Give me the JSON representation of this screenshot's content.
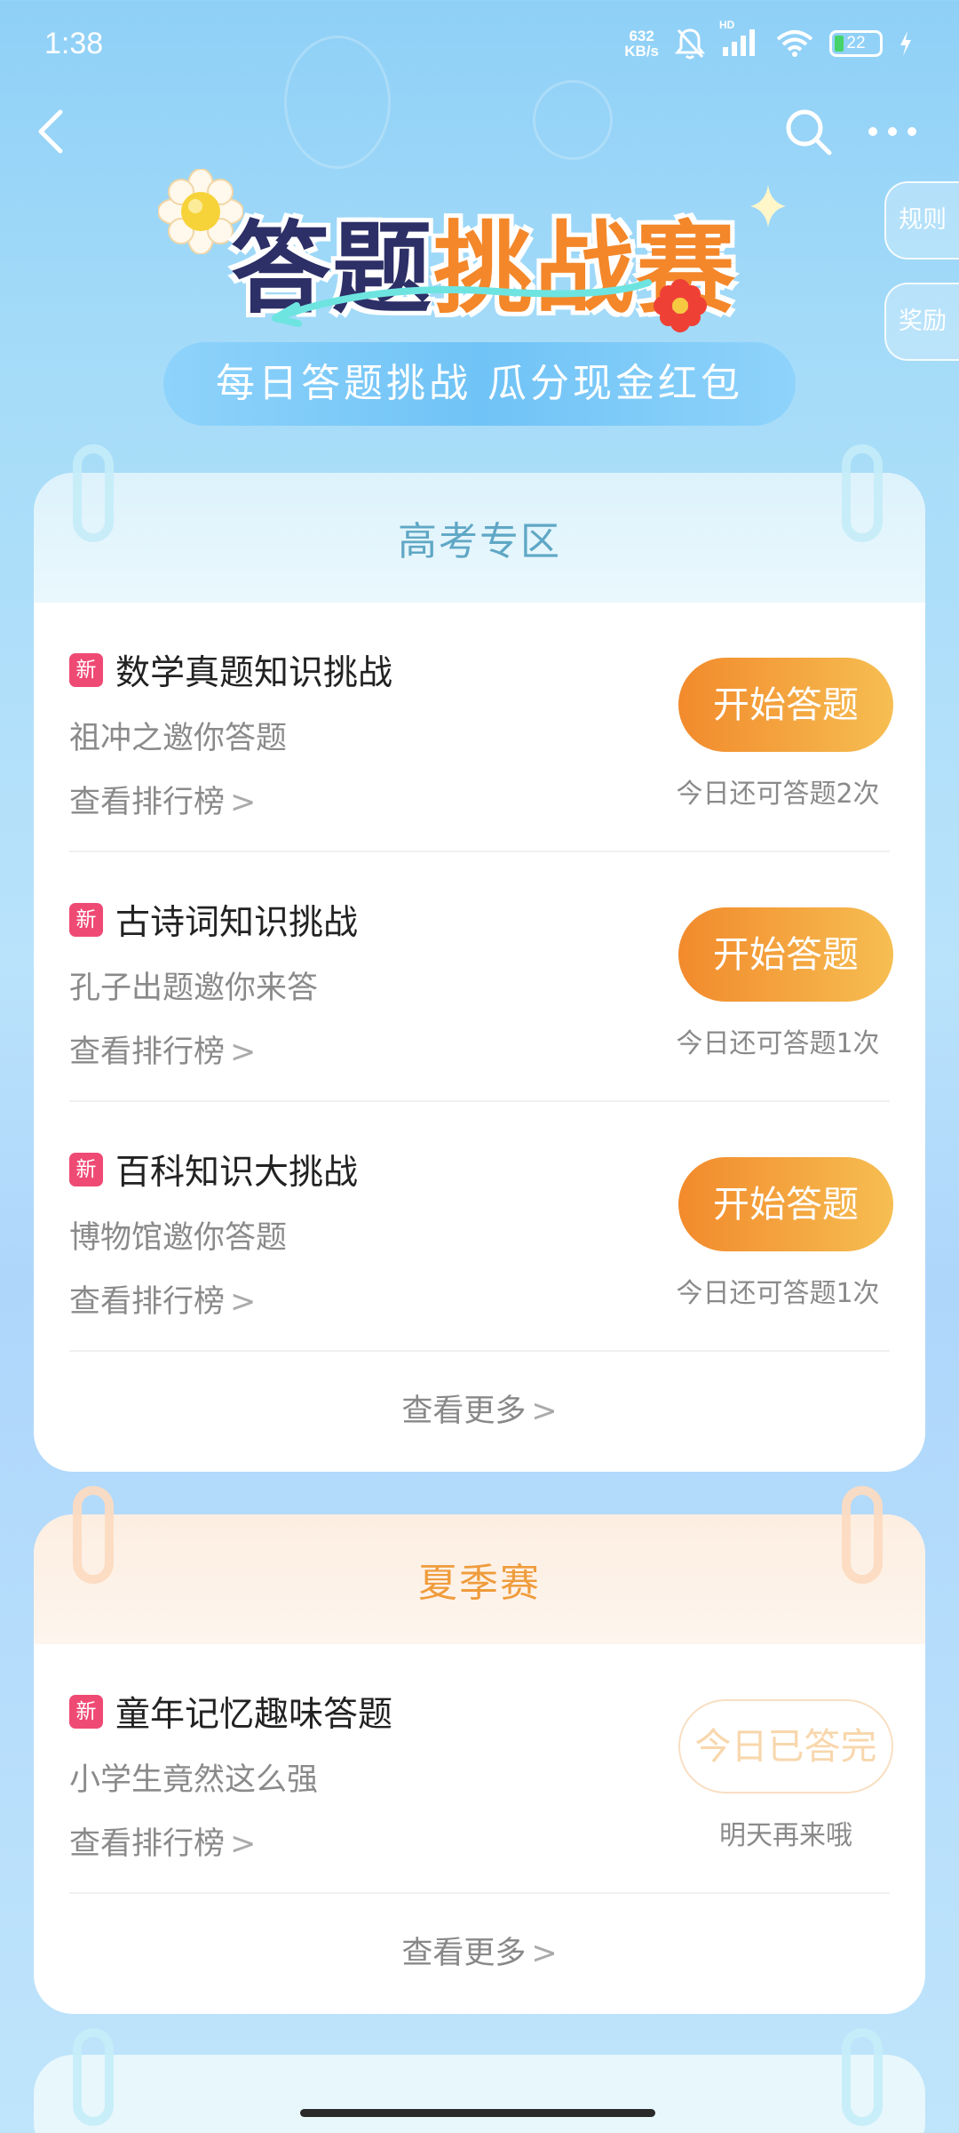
{
  "status_bar": {
    "time": "1:38",
    "net_speed_value": "632",
    "net_speed_unit": "KB/s",
    "hd_label": "HD",
    "battery": "22"
  },
  "side_tabs": {
    "rules": "规则",
    "rewards": "奖励"
  },
  "hero": {
    "title_part1": "答题",
    "title_part2": "挑战赛",
    "subtitle": "每日答题挑战 瓜分现金红包"
  },
  "sections": [
    {
      "header": "高考专区",
      "items": [
        {
          "badge": "新",
          "title": "数学真题知识挑战",
          "subtitle": "祖冲之邀你答题",
          "leaderboard": "查看排行榜",
          "button": "开始答题",
          "remaining": "今日还可答题2次"
        },
        {
          "badge": "新",
          "title": "古诗词知识挑战",
          "subtitle": "孔子出题邀你来答",
          "leaderboard": "查看排行榜",
          "button": "开始答题",
          "remaining": "今日还可答题1次"
        },
        {
          "badge": "新",
          "title": "百科知识大挑战",
          "subtitle": "博物馆邀你答题",
          "leaderboard": "查看排行榜",
          "button": "开始答题",
          "remaining": "今日还可答题1次"
        }
      ],
      "more": "查看更多"
    },
    {
      "header": "夏季赛",
      "items": [
        {
          "badge": "新",
          "title": "童年记忆趣味答题",
          "subtitle": "小学生竟然这么强",
          "leaderboard": "查看排行榜",
          "button": "今日已答完",
          "remaining": "明天再来哦"
        }
      ],
      "more": "查看更多"
    }
  ],
  "colors": {
    "accent_orange": "#f28a2c",
    "badge_red": "#ef4a74",
    "section1_header": "#5fa7c5",
    "section2_header": "#ef9c3c"
  },
  "icons": [
    "back-arrow-icon",
    "search-icon",
    "more-dots-icon",
    "flower-icon",
    "sparkle-icon",
    "chevron-right-icon"
  ]
}
